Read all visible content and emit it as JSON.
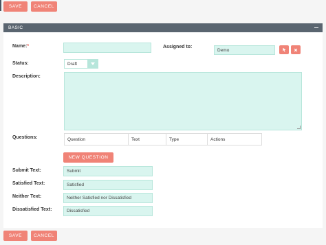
{
  "toolbar": {
    "save_label": "SAVE",
    "cancel_label": "CANCEL"
  },
  "panel": {
    "title": "BASIC"
  },
  "fields": {
    "name": {
      "label": "Name:",
      "required_mark": "*",
      "value": ""
    },
    "assigned": {
      "label": "Assigned to:",
      "value": "Demo"
    },
    "status": {
      "label": "Status:",
      "value": "Draft"
    },
    "description": {
      "label": "Description:",
      "value": ""
    },
    "questions": {
      "label": "Questions:",
      "columns": [
        "Question",
        "Text",
        "Type",
        "Actions"
      ],
      "new_button": "NEW QUESTION"
    },
    "submit_text": {
      "label": "Submit Text:",
      "value": "Submit"
    },
    "satisfied_text": {
      "label": "Satisfied Text:",
      "value": "Satisfied"
    },
    "neither_text": {
      "label": "Neither Text:",
      "value": "Neither Satisfied nor Dissatisfied"
    },
    "dissatisfied_text": {
      "label": "Dissatisfied Text:",
      "value": "Dissatisfied"
    }
  },
  "colors": {
    "accent": "#f08377",
    "field_bg": "#d9f5ef",
    "header_bg": "#5a6570"
  },
  "icons": {
    "select": "cursor-icon",
    "clear": "close-icon",
    "collapse": "minus-icon",
    "dropdown": "chevron-down-icon"
  }
}
